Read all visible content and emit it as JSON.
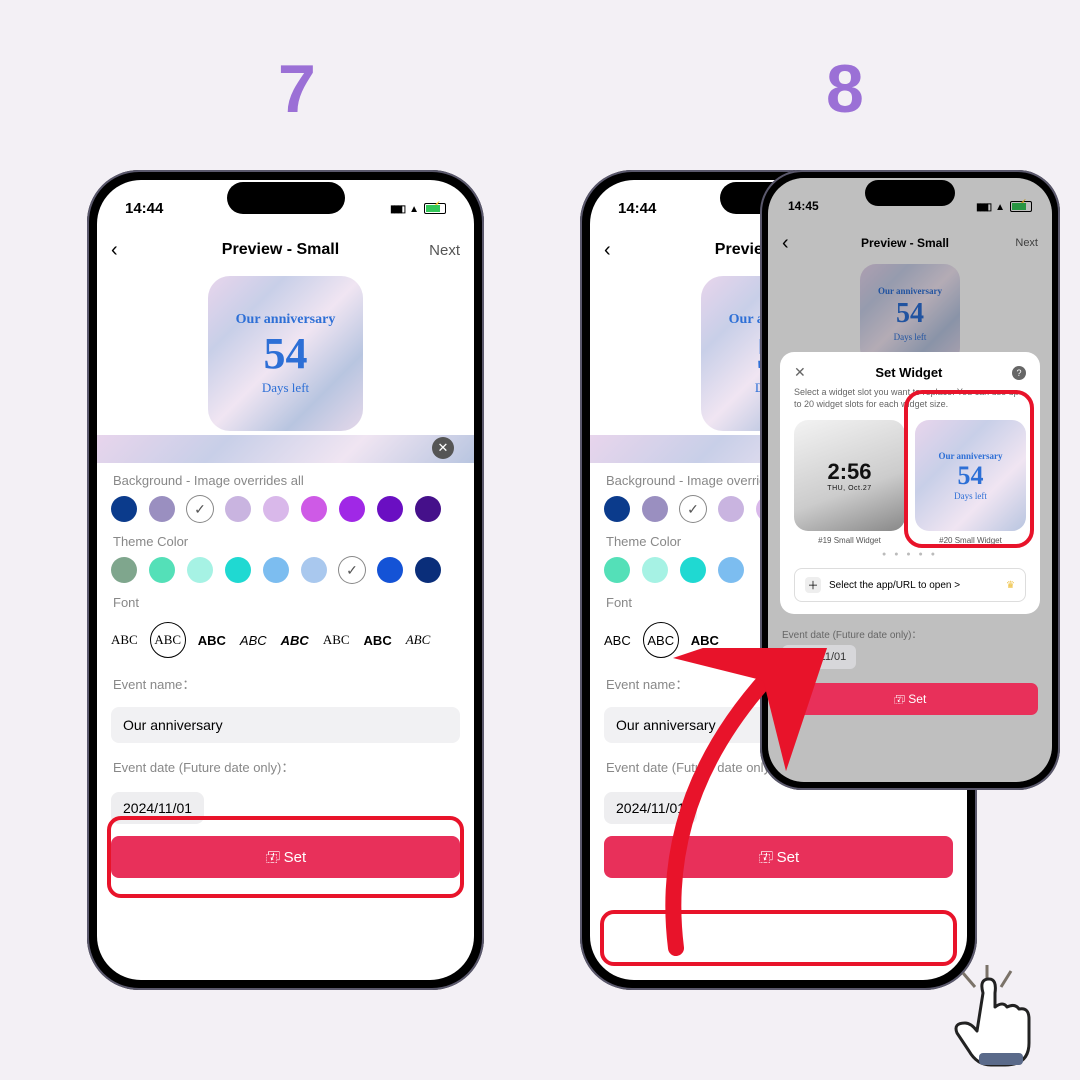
{
  "steps": {
    "seven": "7",
    "eight": "8"
  },
  "status": {
    "time_a": "14:44",
    "time_b": "14:45"
  },
  "nav": {
    "title": "Preview - Small",
    "next": "Next"
  },
  "widget": {
    "title": "Our anniversary",
    "count": "54",
    "sub": "Days left"
  },
  "labels": {
    "background": "Background - Image overrides all",
    "theme": "Theme Color",
    "font": "Font",
    "event_name": "Event name：",
    "event_date": "Event date (Future date only)：",
    "set": "Set"
  },
  "inputs": {
    "event_name_value": "Our anniversary",
    "event_date_value": "2024/11/01"
  },
  "font_sample": "ABC",
  "bg_colors": [
    "#0b3b8c",
    "#9a8fc0",
    "#ffffff",
    "#c9b4e0",
    "#d9b8ea",
    "#ce5ae6",
    "#a028e6",
    "#6a0fc2",
    "#fff",
    "#fff"
  ],
  "theme_colors": [
    "#7fa68d",
    "#54e0b8",
    "#a6f2e4",
    "#1fd9d2",
    "#7cbdf0",
    "#a9c8ee",
    "#2f7de6",
    "#1453d6",
    "#0a2e7a"
  ],
  "theme_selected_index": 6,
  "modal": {
    "title": "Set Widget",
    "subtitle": "Select a widget slot you want to replace.\nYou can use up to 20 widget slots for each widget size.",
    "slot19": {
      "time": "2:56",
      "date": "THU, Oct.27",
      "label": "#19 Small Widget"
    },
    "slot20": {
      "label": "#20 Small Widget"
    },
    "app_select": "Select the app/URL to open >"
  }
}
